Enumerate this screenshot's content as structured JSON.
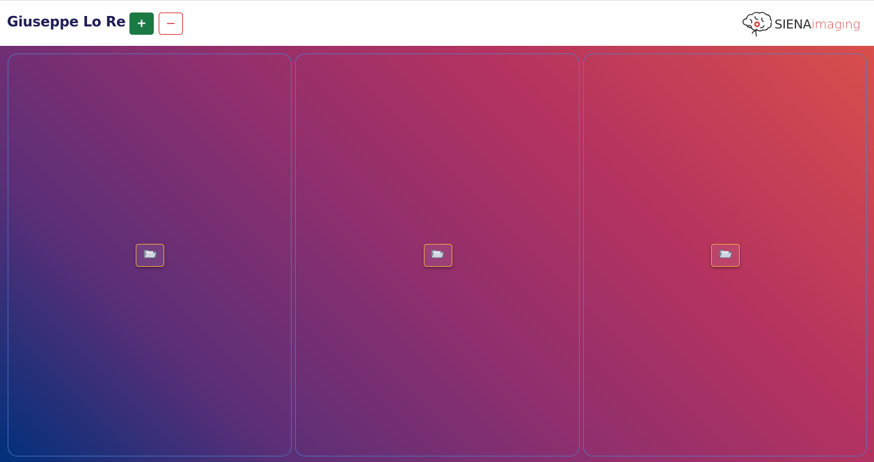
{
  "header": {
    "user_name": "Giuseppe Lo Re",
    "add_label": "+",
    "remove_label": "−",
    "logo": {
      "brand": "SIENA",
      "suffix": "imaging",
      "brand_color": "#2b2b2b",
      "suffix_color": "#d9534f",
      "icon": "brain-icon"
    }
  },
  "colors": {
    "add_button": "#1b7a44",
    "remove_button": "#d9363e",
    "user_name": "#1f1d55",
    "gradient": [
      "#00307a",
      "#5a2f77",
      "#8e2f6e",
      "#b5335f",
      "#d94f4a"
    ],
    "panel_border": "#4d82d4",
    "folder_button_border": "#f0a54a"
  },
  "panels": [
    {
      "id": "panel-1",
      "action_icon": "folder-icon"
    },
    {
      "id": "panel-2",
      "action_icon": "folder-icon"
    },
    {
      "id": "panel-3",
      "action_icon": "folder-icon"
    }
  ]
}
